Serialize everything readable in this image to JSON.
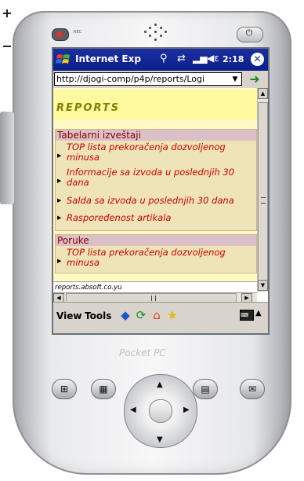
{
  "device": {
    "rec_label": "REC",
    "brand_logo": "Pocket PC",
    "buttons": {
      "power": "power-icon",
      "windows": "windows-icon",
      "calendar": "calendar-icon",
      "contacts": "contacts-icon",
      "inbox": "inbox-icon"
    }
  },
  "titlebar": {
    "app_title": "Internet Exp",
    "time": "2:18",
    "close_glyph": "✕",
    "icons": [
      "start-icon",
      "connectivity-icon",
      "sync-icon",
      "signal-icon",
      "volume-icon"
    ]
  },
  "addressbar": {
    "url": "http://djogi-comp/p4p/reports/Logi"
  },
  "page": {
    "title": "REPORTS",
    "sections": [
      {
        "heading": "Tabelarni izveštaji",
        "links": [
          "TOP lista prekoračenja dozvoljenog minusa",
          "Informacije sa izvoda u poslednjih 30 dana",
          "Salda sa izvoda u poslednjih 30 dana",
          "Raspoređenost artikala"
        ]
      },
      {
        "heading": "Poruke",
        "links": [
          "TOP lista prekoračenja dozvoljenog minusa"
        ]
      }
    ],
    "footer": "reports.absoft.co.yu"
  },
  "toolbar": {
    "view_label": "View",
    "tools_label": "Tools",
    "icons": [
      "back-icon",
      "refresh-icon",
      "home-icon",
      "favorites-icon",
      "keyboard-icon"
    ]
  },
  "colors": {
    "title_bar": "#0a1f8a",
    "page_background": "#fff9c6",
    "section_heading_text": "#8b0000",
    "link_text": "#cc0000",
    "reports_title": "#7f7f00"
  }
}
